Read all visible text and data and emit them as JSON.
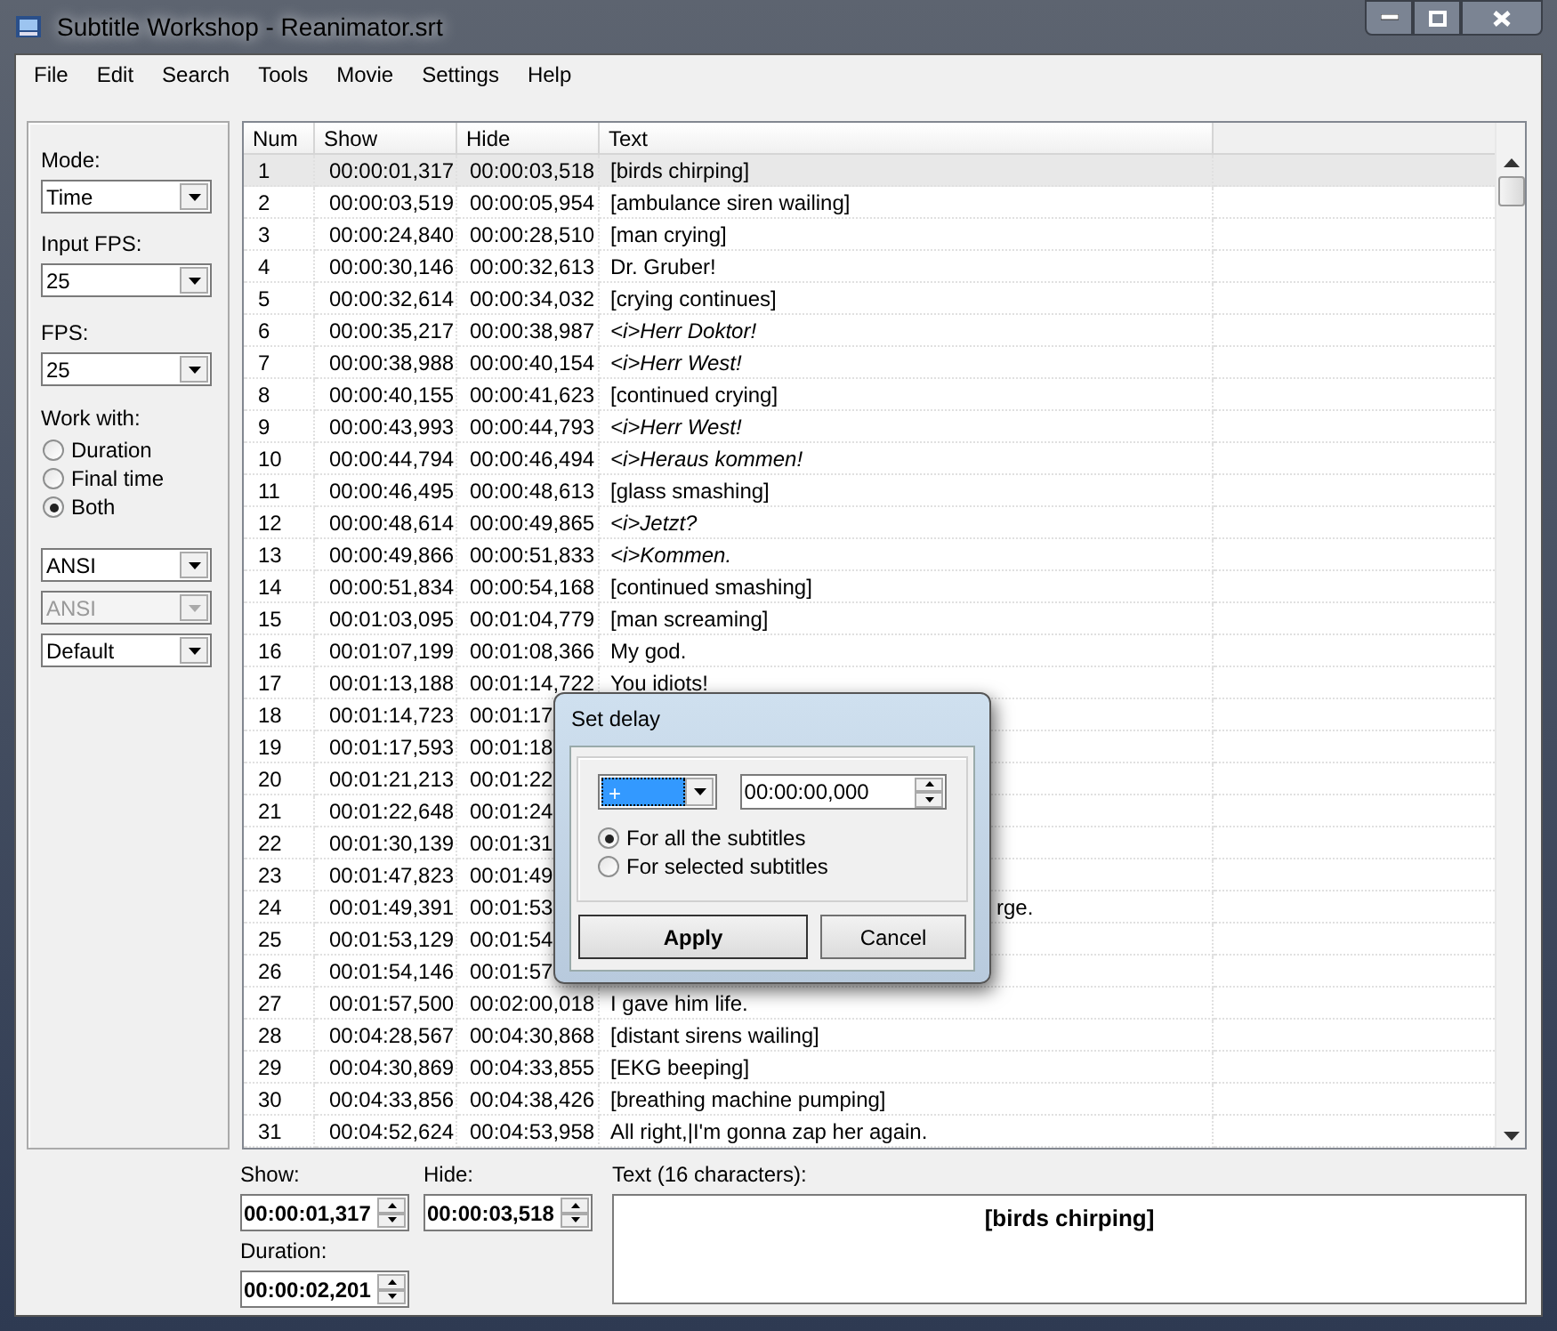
{
  "window": {
    "title": "Subtitle Workshop - Reanimator.srt"
  },
  "menu": [
    "File",
    "Edit",
    "Search",
    "Tools",
    "Movie",
    "Settings",
    "Help"
  ],
  "left_panel": {
    "mode": {
      "label": "Mode:",
      "value": "Time"
    },
    "input_fps": {
      "label": "Input FPS:",
      "value": "25"
    },
    "fps": {
      "label": "FPS:",
      "value": "25"
    },
    "work_with": {
      "label": "Work with:",
      "options": [
        {
          "label": "Duration",
          "selected": false
        },
        {
          "label": "Final time",
          "selected": false
        },
        {
          "label": "Both",
          "selected": true
        }
      ]
    },
    "dropdowns": [
      {
        "value": "ANSI",
        "disabled": false
      },
      {
        "value": "ANSI",
        "disabled": true
      },
      {
        "value": "Default",
        "disabled": false
      }
    ]
  },
  "table": {
    "columns": [
      "Num",
      "Show",
      "Hide",
      "Text"
    ],
    "rows": [
      {
        "num": "1",
        "show": "00:00:01,317",
        "hide": "00:00:03,518",
        "text": "[birds chirping]",
        "selected": true
      },
      {
        "num": "2",
        "show": "00:00:03,519",
        "hide": "00:00:05,954",
        "text": "[ambulance siren wailing]",
        "selected": false
      },
      {
        "num": "3",
        "show": "00:00:24,840",
        "hide": "00:00:28,510",
        "text": "[man crying]",
        "selected": false
      },
      {
        "num": "4",
        "show": "00:00:30,146",
        "hide": "00:00:32,613",
        "text": "Dr. Gruber!",
        "selected": false
      },
      {
        "num": "5",
        "show": "00:00:32,614",
        "hide": "00:00:34,032",
        "text": "[crying continues]",
        "selected": false
      },
      {
        "num": "6",
        "show": "00:00:35,217",
        "hide": "00:00:38,987",
        "text": "<i>Herr Doktor!",
        "italic": true,
        "selected": false
      },
      {
        "num": "7",
        "show": "00:00:38,988",
        "hide": "00:00:40,154",
        "text": "<i>Herr West!",
        "italic": true,
        "selected": false
      },
      {
        "num": "8",
        "show": "00:00:40,155",
        "hide": "00:00:41,623",
        "text": "[continued crying]",
        "selected": false
      },
      {
        "num": "9",
        "show": "00:00:43,993",
        "hide": "00:00:44,793",
        "text": "<i>Herr West!",
        "italic": true,
        "selected": false
      },
      {
        "num": "10",
        "show": "00:00:44,794",
        "hide": "00:00:46,494",
        "text": "<i>Heraus kommen!",
        "italic": true,
        "selected": false
      },
      {
        "num": "11",
        "show": "00:00:46,495",
        "hide": "00:00:48,613",
        "text": "[glass smashing]",
        "selected": false
      },
      {
        "num": "12",
        "show": "00:00:48,614",
        "hide": "00:00:49,865",
        "text": "<i>Jetzt?",
        "italic": true,
        "selected": false
      },
      {
        "num": "13",
        "show": "00:00:49,866",
        "hide": "00:00:51,833",
        "text": "<i>Kommen.",
        "italic": true,
        "selected": false
      },
      {
        "num": "14",
        "show": "00:00:51,834",
        "hide": "00:00:54,168",
        "text": "[continued smashing]",
        "selected": false
      },
      {
        "num": "15",
        "show": "00:01:03,095",
        "hide": "00:01:04,779",
        "text": "[man screaming]",
        "selected": false
      },
      {
        "num": "16",
        "show": "00:01:07,199",
        "hide": "00:01:08,366",
        "text": "My god.",
        "selected": false
      },
      {
        "num": "17",
        "show": "00:01:13,188",
        "hide": "00:01:14,722",
        "text": "You idiots!",
        "selected": false
      },
      {
        "num": "18",
        "show": "00:01:14,723",
        "hide": "00:01:17",
        "selected": false
      },
      {
        "num": "19",
        "show": "00:01:17,593",
        "hide": "00:01:18",
        "selected": false
      },
      {
        "num": "20",
        "show": "00:01:21,213",
        "hide": "00:01:22",
        "selected": false
      },
      {
        "num": "21",
        "show": "00:01:22,648",
        "hide": "00:01:24",
        "selected": false
      },
      {
        "num": "22",
        "show": "00:01:30,139",
        "hide": "00:01:31",
        "selected": false
      },
      {
        "num": "23",
        "show": "00:01:47,823",
        "hide": "00:01:49",
        "selected": false
      },
      {
        "num": "24",
        "show": "00:01:49,391",
        "hide": "00:01:53",
        "text": "rge.",
        "text_tail": true,
        "selected": false
      },
      {
        "num": "25",
        "show": "00:01:53,129",
        "hide": "00:01:54",
        "selected": false
      },
      {
        "num": "26",
        "show": "00:01:54,146",
        "hide": "00:01:57",
        "selected": false
      },
      {
        "num": "27",
        "show": "00:01:57,500",
        "hide": "00:02:00,018",
        "text": "I gave him life.",
        "selected": false
      },
      {
        "num": "28",
        "show": "00:04:28,567",
        "hide": "00:04:30,868",
        "text": "[distant sirens wailing]",
        "selected": false
      },
      {
        "num": "29",
        "show": "00:04:30,869",
        "hide": "00:04:33,855",
        "text": "[EKG beeping]",
        "selected": false
      },
      {
        "num": "30",
        "show": "00:04:33,856",
        "hide": "00:04:38,426",
        "text": "[breathing machine pumping]",
        "selected": false
      },
      {
        "num": "31",
        "show": "00:04:52,624",
        "hide": "00:04:53,958",
        "text": "All right,|I'm gonna zap her again.",
        "selected": false
      }
    ]
  },
  "editor": {
    "show": {
      "label": "Show:",
      "value": "00:00:01,317"
    },
    "hide": {
      "label": "Hide:",
      "value": "00:00:03,518"
    },
    "duration": {
      "label": "Duration:",
      "value": "00:00:02,201"
    },
    "text": {
      "label": "Text (16 characters):",
      "value": "[birds chirping]"
    }
  },
  "dialog": {
    "title": "Set delay",
    "sign": "+",
    "delay": "00:00:00,000",
    "options": [
      {
        "label": "For all the subtitles",
        "selected": true
      },
      {
        "label": "For selected subtitles",
        "selected": false
      }
    ],
    "buttons": [
      {
        "label": "Apply",
        "default": true
      },
      {
        "label": "Cancel",
        "default": false
      }
    ]
  }
}
